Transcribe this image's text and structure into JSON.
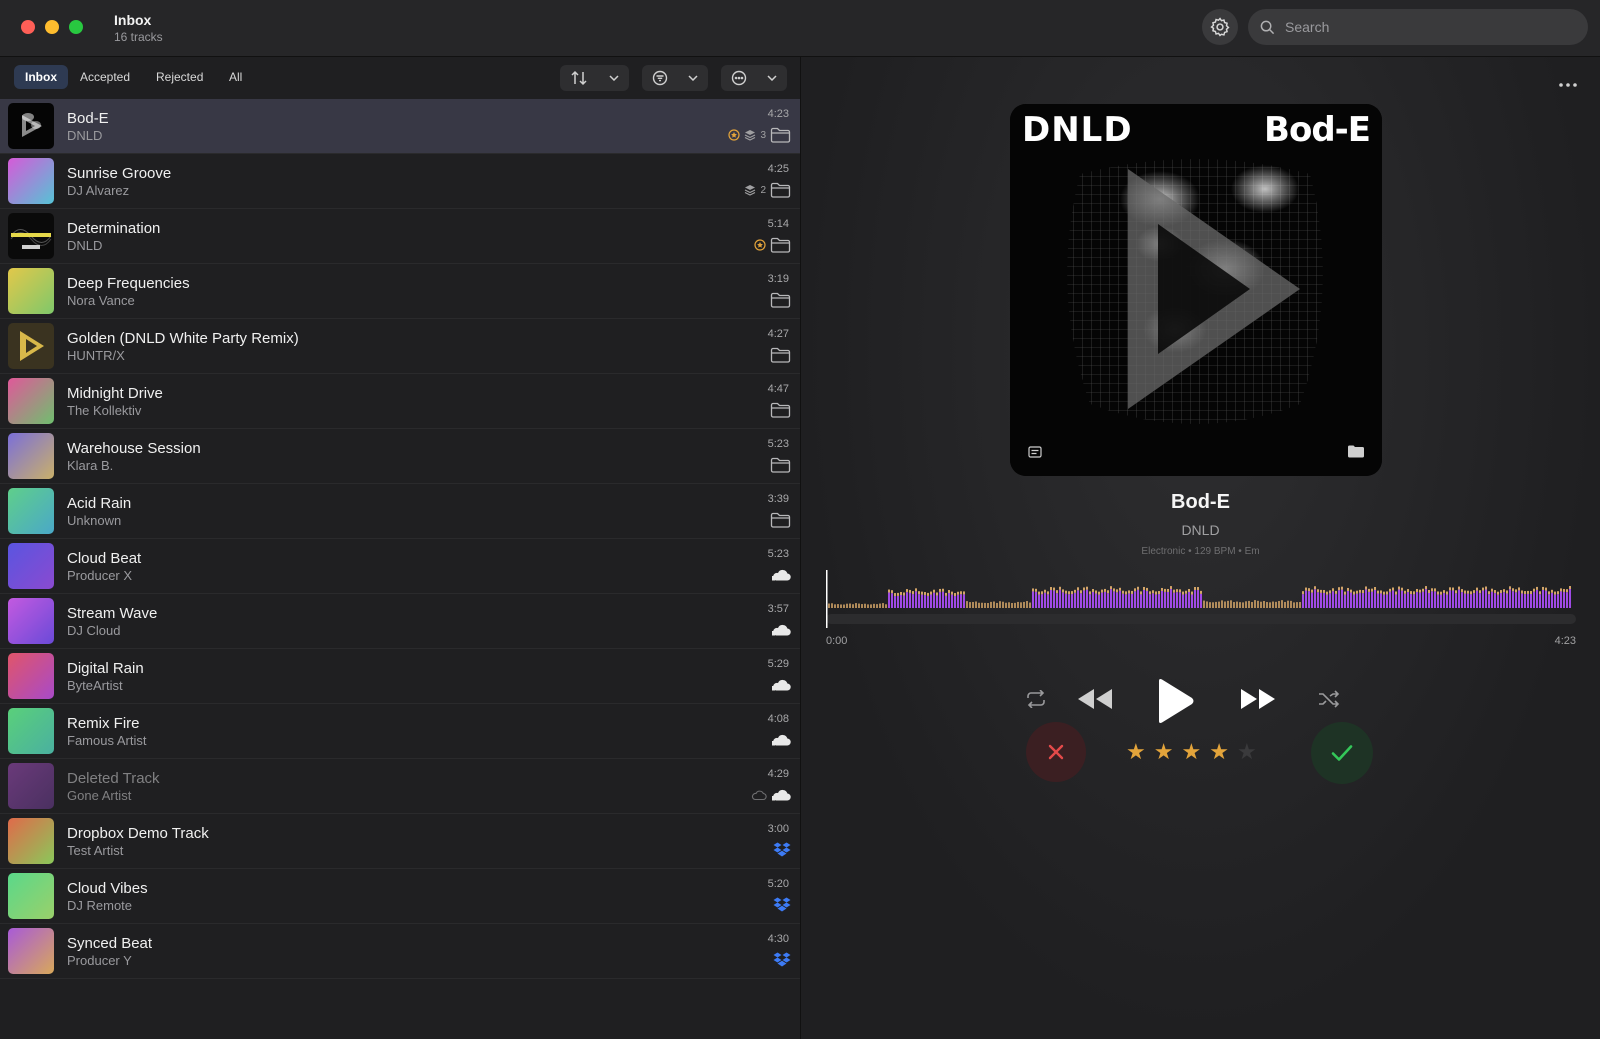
{
  "window": {
    "title": "Inbox",
    "subtitle": "16 tracks"
  },
  "search": {
    "placeholder": "Search"
  },
  "tabs": [
    {
      "label": "Inbox",
      "active": true
    },
    {
      "label": "Accepted",
      "active": false
    },
    {
      "label": "Rejected",
      "active": false
    },
    {
      "label": "All",
      "active": false
    }
  ],
  "tracks": [
    {
      "title": "Bod-E",
      "artist": "DNLD",
      "duration": "4:23",
      "source": "folder",
      "badge": "star",
      "stack": "3",
      "art": "dnld-bode",
      "selected": true
    },
    {
      "title": "Sunrise Groove",
      "artist": "DJ Alvarez",
      "duration": "4:25",
      "source": "folder",
      "stack": "2",
      "colors": [
        "#d65ad8",
        "#55c3d6"
      ]
    },
    {
      "title": "Determination",
      "artist": "DNLD",
      "duration": "5:14",
      "source": "folder",
      "badge": "star",
      "art": "dnld-determination"
    },
    {
      "title": "Deep Frequencies",
      "artist": "Nora Vance",
      "duration": "3:19",
      "source": "folder",
      "colors": [
        "#e2c84a",
        "#7fc86a"
      ]
    },
    {
      "title": "Golden (DNLD White Party Remix)",
      "artist": "HUNTR/X",
      "duration": "4:27",
      "source": "folder",
      "art": "golden"
    },
    {
      "title": "Midnight Drive",
      "artist": "The Kollektiv",
      "duration": "4:47",
      "source": "folder",
      "colors": [
        "#e0589a",
        "#6fbf6e"
      ]
    },
    {
      "title": "Warehouse Session",
      "artist": "Klara B.",
      "duration": "5:23",
      "source": "folder",
      "colors": [
        "#7b6fd8",
        "#c9b06a"
      ]
    },
    {
      "title": "Acid Rain",
      "artist": "Unknown",
      "duration": "3:39",
      "source": "folder",
      "colors": [
        "#5fcf8a",
        "#4aa8c8"
      ]
    },
    {
      "title": "Cloud Beat",
      "artist": "Producer X",
      "duration": "5:23",
      "source": "cloud",
      "colors": [
        "#5a55e0",
        "#8a4ad0"
      ]
    },
    {
      "title": "Stream Wave",
      "artist": "DJ Cloud",
      "duration": "3:57",
      "source": "cloud",
      "colors": [
        "#c35ae0",
        "#6a4ad8"
      ]
    },
    {
      "title": "Digital Rain",
      "artist": "ByteArtist",
      "duration": "5:29",
      "source": "cloud",
      "colors": [
        "#e0556a",
        "#a84ac8"
      ]
    },
    {
      "title": "Remix Fire",
      "artist": "Famous Artist",
      "duration": "4:08",
      "source": "cloud",
      "colors": [
        "#5ad07a",
        "#4ab0a0"
      ]
    },
    {
      "title": "Deleted Track",
      "artist": "Gone Artist",
      "duration": "4:29",
      "source": "cloud",
      "offline": true,
      "dim": true,
      "colors": [
        "#6a3a7a",
        "#4a3060"
      ]
    },
    {
      "title": "Dropbox Demo Track",
      "artist": "Test Artist",
      "duration": "3:00",
      "source": "dropbox",
      "colors": [
        "#e06a4a",
        "#8ac85a"
      ]
    },
    {
      "title": "Cloud Vibes",
      "artist": "DJ Remote",
      "duration": "5:20",
      "source": "dropbox",
      "colors": [
        "#5ad88a",
        "#9ad06a"
      ]
    },
    {
      "title": "Synced Beat",
      "artist": "Producer Y",
      "duration": "4:30",
      "source": "dropbox",
      "colors": [
        "#a85ad8",
        "#d8a85a"
      ]
    }
  ],
  "now_playing": {
    "title": "Bod-E",
    "artist": "DNLD",
    "meta": "Electronic • 129 BPM • Em",
    "art_logo": "DNLD",
    "art_title": "Bod-E",
    "time_start": "0:00",
    "time_end": "4:23",
    "progress": 0,
    "rating": 4,
    "rating_max": 5
  },
  "colors": {
    "accent_waveform": "#a64df0",
    "waveform_dim": "#d2a468",
    "star": "#e3a43b",
    "reject": "#e44a4a",
    "accept": "#34c759",
    "dropbox": "#3d7bf5"
  }
}
